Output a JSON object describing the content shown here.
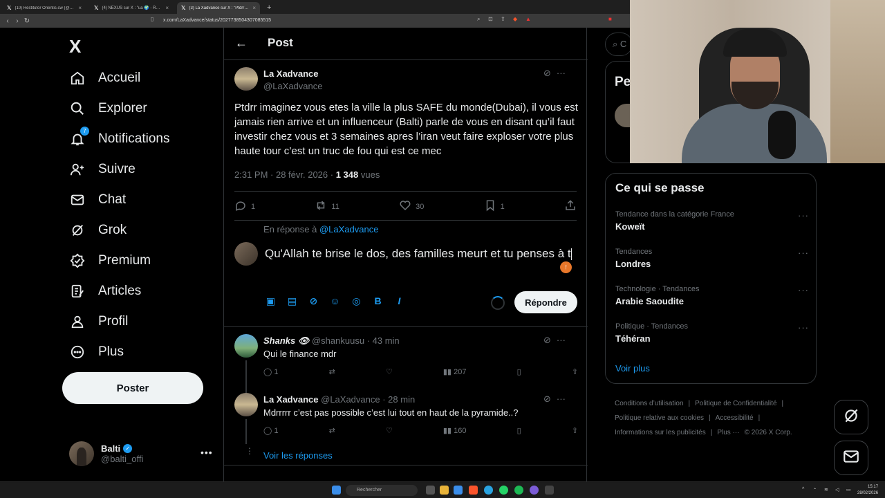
{
  "browser": {
    "tabs": [
      {
        "title": "(10) Restitutor Orientis.cw (@restituto",
        "active": false
      },
      {
        "title": "(4) NEXUS sur X : \"ua 🌍 - ROYAUME",
        "active": false
      },
      {
        "title": "(3) La Xadvance sur X : \"Ptdrr ima",
        "active": true
      }
    ],
    "url": "x.com/LaXadvance/status/2027738504307085515"
  },
  "sidebar": {
    "logo": "X",
    "items": [
      {
        "label": "Accueil"
      },
      {
        "label": "Explorer"
      },
      {
        "label": "Notifications",
        "badge": "7"
      },
      {
        "label": "Suivre"
      },
      {
        "label": "Chat"
      },
      {
        "label": "Grok"
      },
      {
        "label": "Premium"
      },
      {
        "label": "Articles"
      },
      {
        "label": "Profil"
      },
      {
        "label": "Plus"
      }
    ],
    "post_button": "Poster",
    "account": {
      "name": "Balti",
      "handle": "@balti_offi"
    }
  },
  "main": {
    "header_title": "Post",
    "post": {
      "author": "La Xadvance",
      "handle": "@LaXadvance",
      "text": "Ptdrr imaginez vous etes la ville la plus SAFE du monde(Dubai), il vous est jamais rien arrive et un influenceur (Balti) parle de vous en disant qu’il faut investir chez vous et 3 semaines apres l’iran veut faire exploser votre plus haute tour c’est un truc de fou qui est ce mec",
      "time": "2:31 PM · 28 févr. 2026 · ",
      "views_count": "1 348",
      "views_label": " vues",
      "replies": "1",
      "reposts": "11",
      "likes": "30",
      "bookmarks": "1"
    },
    "reply_to_prefix": "En réponse à ",
    "reply_to_handle": "@LaXadvance",
    "composer_text": "Qu'Allah te brise le dos, des familles meurt et tu penses à t",
    "reply_button": "Répondre",
    "replies": [
      {
        "name": "Shanks 👁",
        "handle": "@shankuusu",
        "time": "· 43 min",
        "text": "Qui le finance mdr",
        "replies": "1",
        "views": "207"
      },
      {
        "name": "La Xadvance",
        "handle": "@LaXadvance",
        "time": "· 28 min",
        "text": "Mdrrrrr c’est pas possible c’est lui tout en haut de la pyramide..?",
        "replies": "1",
        "views": "160"
      }
    ],
    "see_replies": "Voir les réponses"
  },
  "right": {
    "search_placeholder": "C",
    "peek_label": "Pe",
    "trends_title": "Ce qui se passe",
    "trends": [
      {
        "category": "Tendance dans la catégorie France",
        "name": "Koweït"
      },
      {
        "category": "Tendances",
        "name": "Londres"
      },
      {
        "category": "Technologie · Tendances",
        "name": "Arabie Saoudite"
      },
      {
        "category": "Politique · Tendances",
        "name": "Téhéran"
      }
    ],
    "see_more": "Voir plus",
    "footer": [
      "Conditions d’utilisation",
      "|",
      "Politique de Confidentialité",
      "|",
      "Politique relative aux cookies",
      "|",
      "Accessibilité",
      "|",
      "Informations sur les publicités",
      "|",
      "Plus ···",
      "© 2026 X Corp."
    ]
  },
  "taskbar": {
    "search": "Rechercher",
    "time": "15:17",
    "date": "28/02/2026"
  },
  "colors": {
    "accent": "#1d9bf0",
    "background": "#000000",
    "border": "#2f3336",
    "muted": "#71767b"
  }
}
